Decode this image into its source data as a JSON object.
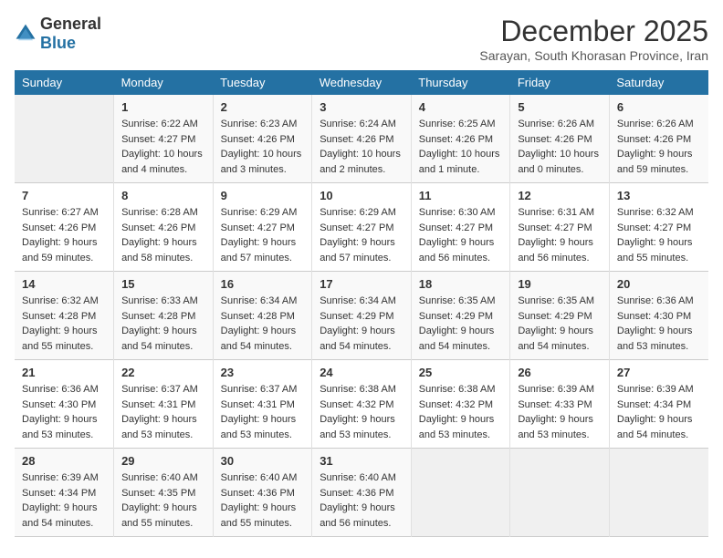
{
  "header": {
    "logo_general": "General",
    "logo_blue": "Blue",
    "month_title": "December 2025",
    "subtitle": "Sarayan, South Khorasan Province, Iran"
  },
  "weekdays": [
    "Sunday",
    "Monday",
    "Tuesday",
    "Wednesday",
    "Thursday",
    "Friday",
    "Saturday"
  ],
  "weeks": [
    [
      {
        "day": "",
        "empty": true
      },
      {
        "day": "1",
        "sunrise": "Sunrise: 6:22 AM",
        "sunset": "Sunset: 4:27 PM",
        "daylight": "Daylight: 10 hours and 4 minutes."
      },
      {
        "day": "2",
        "sunrise": "Sunrise: 6:23 AM",
        "sunset": "Sunset: 4:26 PM",
        "daylight": "Daylight: 10 hours and 3 minutes."
      },
      {
        "day": "3",
        "sunrise": "Sunrise: 6:24 AM",
        "sunset": "Sunset: 4:26 PM",
        "daylight": "Daylight: 10 hours and 2 minutes."
      },
      {
        "day": "4",
        "sunrise": "Sunrise: 6:25 AM",
        "sunset": "Sunset: 4:26 PM",
        "daylight": "Daylight: 10 hours and 1 minute."
      },
      {
        "day": "5",
        "sunrise": "Sunrise: 6:26 AM",
        "sunset": "Sunset: 4:26 PM",
        "daylight": "Daylight: 10 hours and 0 minutes."
      },
      {
        "day": "6",
        "sunrise": "Sunrise: 6:26 AM",
        "sunset": "Sunset: 4:26 PM",
        "daylight": "Daylight: 9 hours and 59 minutes."
      }
    ],
    [
      {
        "day": "7",
        "sunrise": "Sunrise: 6:27 AM",
        "sunset": "Sunset: 4:26 PM",
        "daylight": "Daylight: 9 hours and 59 minutes."
      },
      {
        "day": "8",
        "sunrise": "Sunrise: 6:28 AM",
        "sunset": "Sunset: 4:26 PM",
        "daylight": "Daylight: 9 hours and 58 minutes."
      },
      {
        "day": "9",
        "sunrise": "Sunrise: 6:29 AM",
        "sunset": "Sunset: 4:27 PM",
        "daylight": "Daylight: 9 hours and 57 minutes."
      },
      {
        "day": "10",
        "sunrise": "Sunrise: 6:29 AM",
        "sunset": "Sunset: 4:27 PM",
        "daylight": "Daylight: 9 hours and 57 minutes."
      },
      {
        "day": "11",
        "sunrise": "Sunrise: 6:30 AM",
        "sunset": "Sunset: 4:27 PM",
        "daylight": "Daylight: 9 hours and 56 minutes."
      },
      {
        "day": "12",
        "sunrise": "Sunrise: 6:31 AM",
        "sunset": "Sunset: 4:27 PM",
        "daylight": "Daylight: 9 hours and 56 minutes."
      },
      {
        "day": "13",
        "sunrise": "Sunrise: 6:32 AM",
        "sunset": "Sunset: 4:27 PM",
        "daylight": "Daylight: 9 hours and 55 minutes."
      }
    ],
    [
      {
        "day": "14",
        "sunrise": "Sunrise: 6:32 AM",
        "sunset": "Sunset: 4:28 PM",
        "daylight": "Daylight: 9 hours and 55 minutes."
      },
      {
        "day": "15",
        "sunrise": "Sunrise: 6:33 AM",
        "sunset": "Sunset: 4:28 PM",
        "daylight": "Daylight: 9 hours and 54 minutes."
      },
      {
        "day": "16",
        "sunrise": "Sunrise: 6:34 AM",
        "sunset": "Sunset: 4:28 PM",
        "daylight": "Daylight: 9 hours and 54 minutes."
      },
      {
        "day": "17",
        "sunrise": "Sunrise: 6:34 AM",
        "sunset": "Sunset: 4:29 PM",
        "daylight": "Daylight: 9 hours and 54 minutes."
      },
      {
        "day": "18",
        "sunrise": "Sunrise: 6:35 AM",
        "sunset": "Sunset: 4:29 PM",
        "daylight": "Daylight: 9 hours and 54 minutes."
      },
      {
        "day": "19",
        "sunrise": "Sunrise: 6:35 AM",
        "sunset": "Sunset: 4:29 PM",
        "daylight": "Daylight: 9 hours and 54 minutes."
      },
      {
        "day": "20",
        "sunrise": "Sunrise: 6:36 AM",
        "sunset": "Sunset: 4:30 PM",
        "daylight": "Daylight: 9 hours and 53 minutes."
      }
    ],
    [
      {
        "day": "21",
        "sunrise": "Sunrise: 6:36 AM",
        "sunset": "Sunset: 4:30 PM",
        "daylight": "Daylight: 9 hours and 53 minutes."
      },
      {
        "day": "22",
        "sunrise": "Sunrise: 6:37 AM",
        "sunset": "Sunset: 4:31 PM",
        "daylight": "Daylight: 9 hours and 53 minutes."
      },
      {
        "day": "23",
        "sunrise": "Sunrise: 6:37 AM",
        "sunset": "Sunset: 4:31 PM",
        "daylight": "Daylight: 9 hours and 53 minutes."
      },
      {
        "day": "24",
        "sunrise": "Sunrise: 6:38 AM",
        "sunset": "Sunset: 4:32 PM",
        "daylight": "Daylight: 9 hours and 53 minutes."
      },
      {
        "day": "25",
        "sunrise": "Sunrise: 6:38 AM",
        "sunset": "Sunset: 4:32 PM",
        "daylight": "Daylight: 9 hours and 53 minutes."
      },
      {
        "day": "26",
        "sunrise": "Sunrise: 6:39 AM",
        "sunset": "Sunset: 4:33 PM",
        "daylight": "Daylight: 9 hours and 53 minutes."
      },
      {
        "day": "27",
        "sunrise": "Sunrise: 6:39 AM",
        "sunset": "Sunset: 4:34 PM",
        "daylight": "Daylight: 9 hours and 54 minutes."
      }
    ],
    [
      {
        "day": "28",
        "sunrise": "Sunrise: 6:39 AM",
        "sunset": "Sunset: 4:34 PM",
        "daylight": "Daylight: 9 hours and 54 minutes."
      },
      {
        "day": "29",
        "sunrise": "Sunrise: 6:40 AM",
        "sunset": "Sunset: 4:35 PM",
        "daylight": "Daylight: 9 hours and 55 minutes."
      },
      {
        "day": "30",
        "sunrise": "Sunrise: 6:40 AM",
        "sunset": "Sunset: 4:36 PM",
        "daylight": "Daylight: 9 hours and 55 minutes."
      },
      {
        "day": "31",
        "sunrise": "Sunrise: 6:40 AM",
        "sunset": "Sunset: 4:36 PM",
        "daylight": "Daylight: 9 hours and 56 minutes."
      },
      {
        "day": "",
        "empty": true
      },
      {
        "day": "",
        "empty": true
      },
      {
        "day": "",
        "empty": true
      }
    ]
  ]
}
